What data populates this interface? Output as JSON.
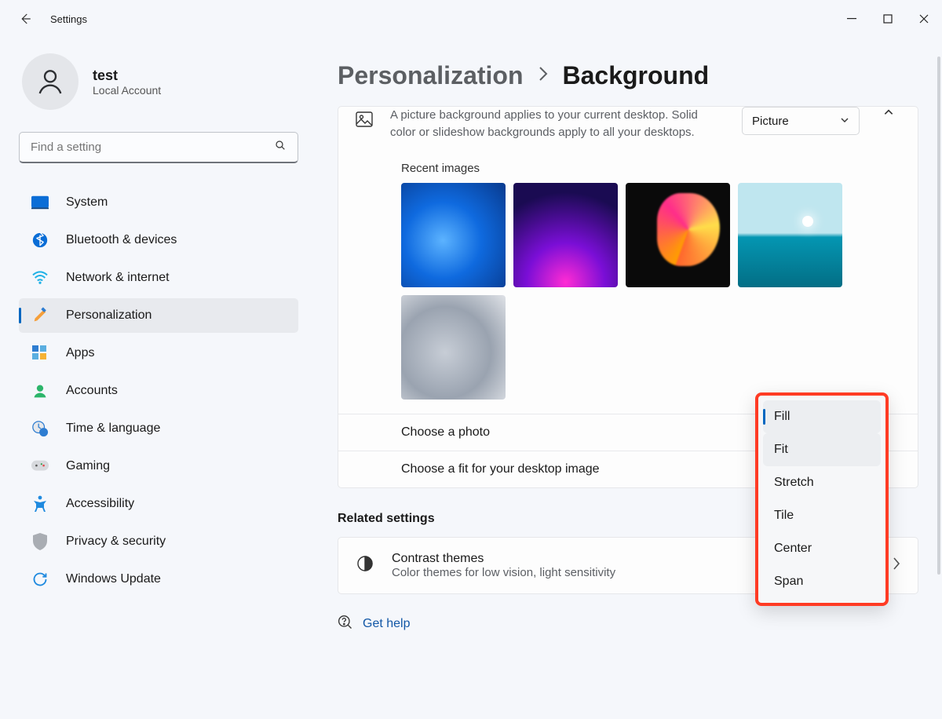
{
  "titlebar": {
    "title": "Settings"
  },
  "user": {
    "name": "test",
    "account_type": "Local Account"
  },
  "search": {
    "placeholder": "Find a setting"
  },
  "nav": {
    "items": [
      {
        "label": "System"
      },
      {
        "label": "Bluetooth & devices"
      },
      {
        "label": "Network & internet"
      },
      {
        "label": "Personalization"
      },
      {
        "label": "Apps"
      },
      {
        "label": "Accounts"
      },
      {
        "label": "Time & language"
      },
      {
        "label": "Gaming"
      },
      {
        "label": "Accessibility"
      },
      {
        "label": "Privacy & security"
      },
      {
        "label": "Windows Update"
      }
    ],
    "active_index": 3
  },
  "breadcrumb": {
    "parent": "Personalization",
    "current": "Background"
  },
  "background_card": {
    "description": "A picture background applies to your current desktop. Solid color or slideshow backgrounds apply to all your desktops.",
    "dropdown_value": "Picture",
    "recent_images_label": "Recent images",
    "choose_photo_label": "Choose a photo",
    "choose_fit_label": "Choose a fit for your desktop image"
  },
  "fit_menu": {
    "options": [
      "Fill",
      "Fit",
      "Stretch",
      "Tile",
      "Center",
      "Span"
    ],
    "selected_index": 0,
    "hover_index": 1
  },
  "related": {
    "section_title": "Related settings",
    "contrast": {
      "title": "Contrast themes",
      "subtitle": "Color themes for low vision, light sensitivity"
    }
  },
  "help": {
    "label": "Get help"
  }
}
